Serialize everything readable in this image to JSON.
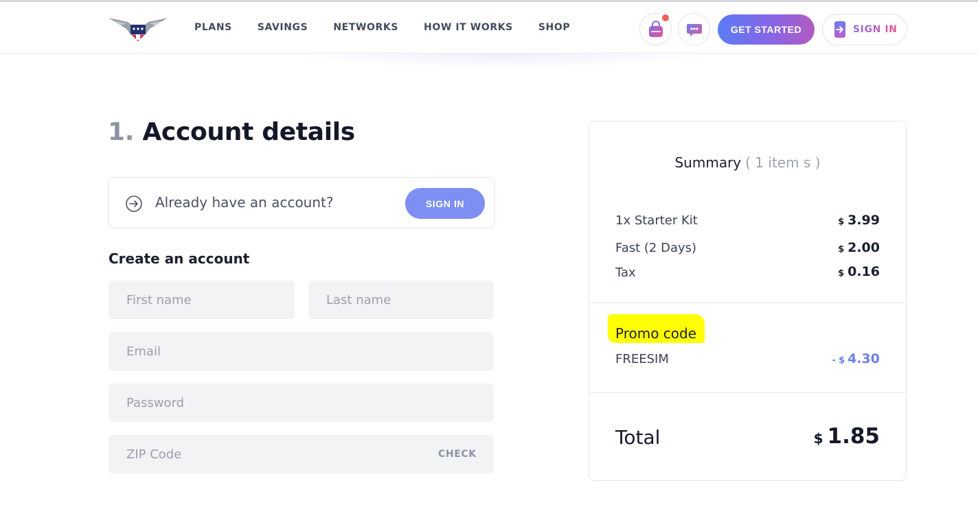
{
  "header": {
    "nav": [
      "PLANS",
      "SAVINGS",
      "NETWORKS",
      "HOW IT WORKS",
      "SHOP"
    ],
    "get_started": "GET STARTED",
    "sign_in": "SIGN IN",
    "icons": [
      "shopping-bag-icon",
      "chat-icon",
      "sign-in-arrow-icon"
    ]
  },
  "main": {
    "step_number": "1.",
    "title": "Account details",
    "signin_prompt": "Already have an account?",
    "signin_button": "SIGN IN",
    "create_heading": "Create an account",
    "fields": {
      "first_name": "First name",
      "last_name": "Last name",
      "email": "Email",
      "password": "Password",
      "zip": "ZIP Code"
    },
    "check_button": "CHECK"
  },
  "summary": {
    "title": "Summary",
    "count": "( 1 item s )",
    "currency": "$",
    "items": [
      {
        "label": "1x Starter Kit",
        "value": "3.99"
      },
      {
        "label": "Fast (2 Days)",
        "value": "2.00"
      },
      {
        "label": "Tax",
        "value": "0.16"
      }
    ],
    "promo_label": "Promo code",
    "promo_code": "FREESIM",
    "discount_prefix": "-",
    "discount": "4.30",
    "total_label": "Total",
    "total": "1.85"
  },
  "colors": {
    "accent": "#7d8ff3",
    "gradient_start": "#5b7cf5",
    "gradient_end": "#b25bc0",
    "highlight": "#ffff00",
    "notification": "#f45b5b"
  }
}
